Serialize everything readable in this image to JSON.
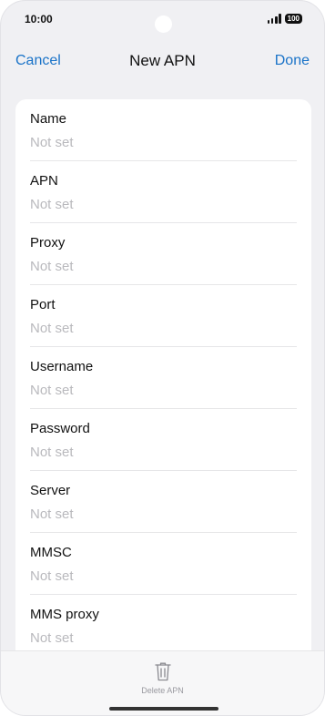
{
  "status": {
    "time": "10:00",
    "battery": "100"
  },
  "nav": {
    "cancel": "Cancel",
    "title": "New APN",
    "done": "Done"
  },
  "fields": [
    {
      "label": "Name",
      "value": "Not set"
    },
    {
      "label": "APN",
      "value": "Not set"
    },
    {
      "label": "Proxy",
      "value": "Not set"
    },
    {
      "label": "Port",
      "value": "Not set"
    },
    {
      "label": "Username",
      "value": "Not set"
    },
    {
      "label": "Password",
      "value": "Not set"
    },
    {
      "label": "Server",
      "value": "Not set"
    },
    {
      "label": "MMSC",
      "value": "Not set"
    },
    {
      "label": "MMS proxy",
      "value": "Not set"
    }
  ],
  "bottom": {
    "delete_label": "Delete APN",
    "delete_icon": "trash-icon"
  },
  "colors": {
    "accent": "#1a73c8",
    "placeholder": "#b9b9bd",
    "background": "#f0f0f3"
  }
}
